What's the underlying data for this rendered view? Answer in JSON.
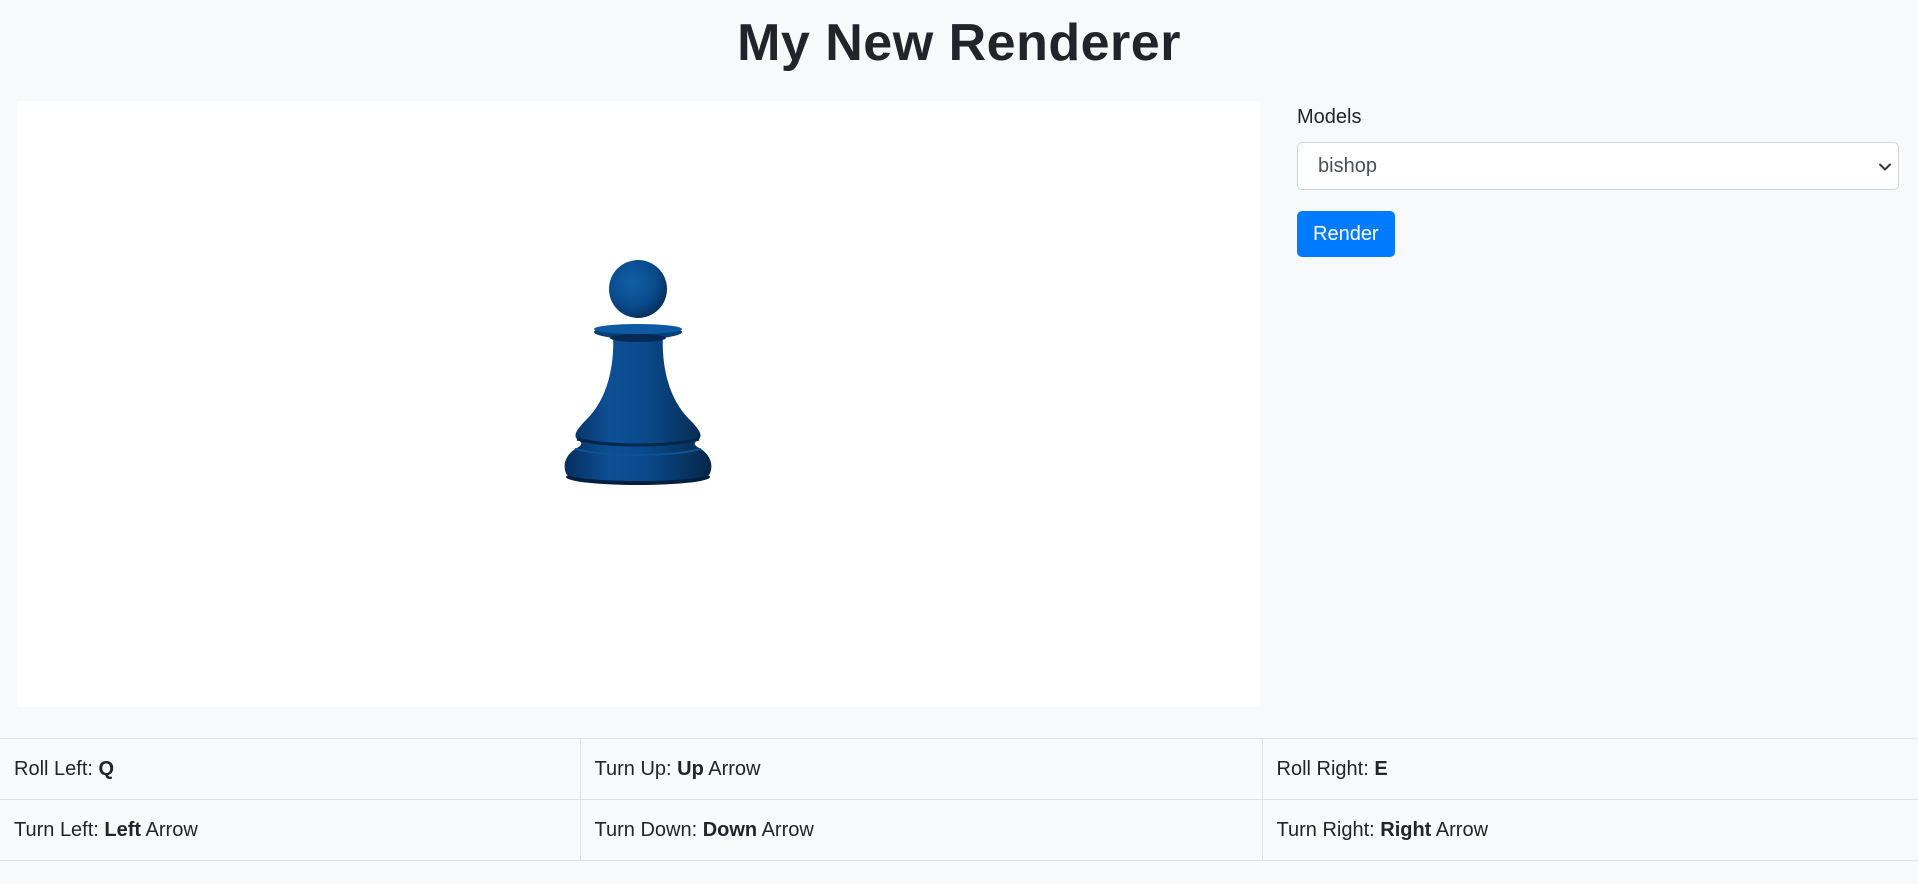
{
  "header": {
    "title": "My New Renderer"
  },
  "viewport": {
    "model_color": "#0a4a8c",
    "background": "#ffffff"
  },
  "panel": {
    "models_label": "Models",
    "model_select": {
      "selected": "bishop",
      "options": [
        "bishop"
      ]
    },
    "render_button_label": "Render",
    "accent_color": "#007bff"
  },
  "controls": {
    "rows": [
      [
        {
          "action": "Roll Left:",
          "key": "Q",
          "suffix": ""
        },
        {
          "action": "Turn Up:",
          "key": "Up",
          "suffix": "Arrow"
        },
        {
          "action": "Roll Right:",
          "key": "E",
          "suffix": ""
        }
      ],
      [
        {
          "action": "Turn Left:",
          "key": "Left",
          "suffix": "Arrow"
        },
        {
          "action": "Turn Down:",
          "key": "Down",
          "suffix": "Arrow"
        },
        {
          "action": "Turn Right:",
          "key": "Right",
          "suffix": "Arrow"
        }
      ]
    ]
  }
}
